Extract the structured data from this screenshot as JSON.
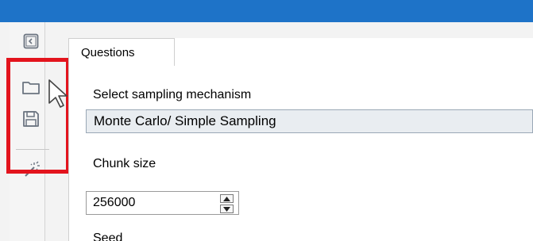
{
  "window": {
    "title_bar_color": "#1e73c8"
  },
  "toolbar": {
    "items": [
      {
        "icon": "back-icon"
      },
      {
        "icon": "folder-icon"
      },
      {
        "icon": "save-icon"
      },
      {
        "icon": "magic-wand-icon"
      }
    ],
    "highlight_color": "#e3141d"
  },
  "tabs": [
    {
      "label": "Questions",
      "active": true
    }
  ],
  "form": {
    "sampling_label": "Select sampling mechanism",
    "sampling_value": "Monte Carlo/ Simple Sampling",
    "chunk_label": "Chunk size",
    "chunk_value": "256000",
    "seed_label": "Seed"
  }
}
